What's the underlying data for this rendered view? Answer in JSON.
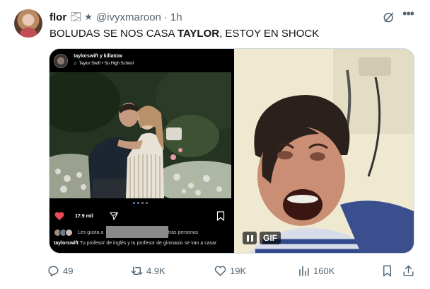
{
  "tweet": {
    "author_name": "flor",
    "badge_icons": "🌫 ★",
    "handle": "@ivyxmaroon",
    "separator": "·",
    "time": "1h",
    "text_before": "BOLUDAS SE NOS CASA ",
    "text_bold": "TAYLOR",
    "text_after": ", ESTOY EN SHOCK"
  },
  "media": {
    "instagram": {
      "users": "taylorswift y killatrav",
      "song": "Taylor Swift • So High School",
      "likes": "17.9 mil",
      "liked_by_prefix": "Les gusta a",
      "liked_by_suffix": "otras personas",
      "caption_user": "taylorswift",
      "caption_text": "Tu profesor de inglés y tu profesor de gimnasio se van a casar",
      "heart_color": "#ed4956"
    },
    "gif": {
      "label": "GIF"
    }
  },
  "actions": {
    "replies": "49",
    "reposts": "4.9K",
    "likes": "19K",
    "views": "160K"
  },
  "icons": {
    "more": "more-icon",
    "grok": "grok-icon",
    "reply": "reply-icon",
    "repost": "repost-icon",
    "like": "heart-icon",
    "views": "views-icon",
    "bookmark": "bookmark-icon",
    "share": "share-icon"
  },
  "colors": {
    "text": "#0f1419",
    "muted": "#536471",
    "border": "#cfd9de"
  }
}
